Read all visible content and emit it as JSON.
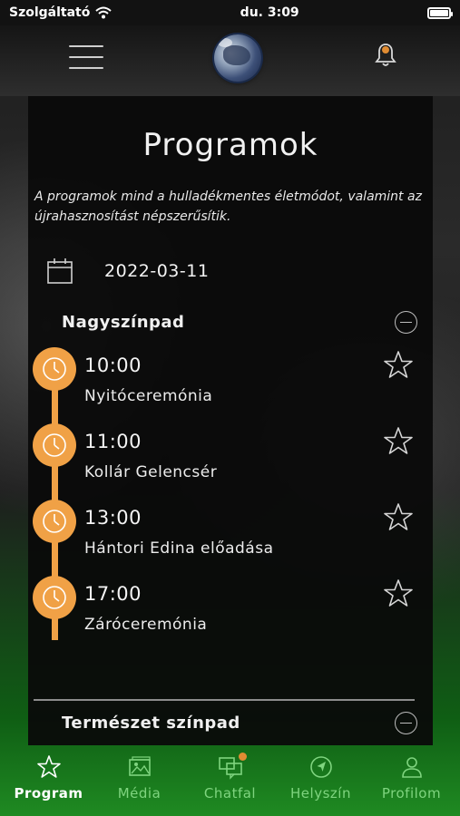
{
  "status_bar": {
    "carrier": "Szolgáltató",
    "time": "du. 3:09"
  },
  "page": {
    "title": "Programok",
    "description": "A programok mind a hulladékmentes életmódot, valamint az újrahasznosítást népszerűsítik.",
    "date": "2022-03-11"
  },
  "stages": [
    {
      "name": "Nagyszínpad",
      "events": [
        {
          "time": "10:00",
          "title": "Nyitóceremónia"
        },
        {
          "time": "11:00",
          "title": "Kollár Gelencsér"
        },
        {
          "time": "13:00",
          "title": "Hántori Edina előadása"
        },
        {
          "time": "17:00",
          "title": "Záróceremónia"
        }
      ]
    },
    {
      "name": "Természet színpad",
      "events": []
    }
  ],
  "tabs": [
    {
      "label": "Program",
      "icon": "star-icon",
      "active": true
    },
    {
      "label": "Média",
      "icon": "image-icon",
      "active": false
    },
    {
      "label": "Chatfal",
      "icon": "chat-icon",
      "active": false
    },
    {
      "label": "Helyszín",
      "icon": "location-icon",
      "active": false
    },
    {
      "label": "Profilom",
      "icon": "user-icon",
      "active": false
    }
  ],
  "colors": {
    "accent": "#f0a146",
    "active_tab": "#ffffff",
    "inactive_tab": "#7fd47f",
    "notification_dot": "#e08c33"
  }
}
